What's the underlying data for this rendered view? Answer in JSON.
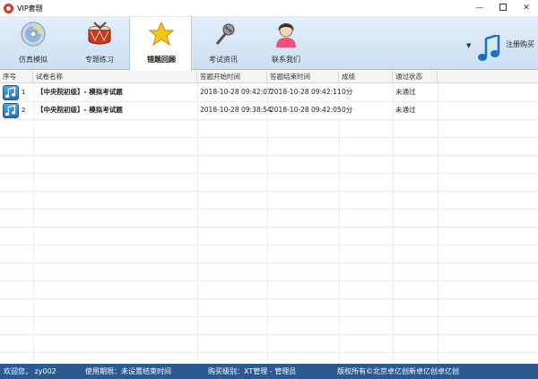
{
  "window": {
    "title": "VIP套题"
  },
  "toolbar": {
    "tools": [
      {
        "label": "仿真模拟",
        "icon": "cd-icon"
      },
      {
        "label": "专题练习",
        "icon": "drum-icon"
      },
      {
        "label": "错题回顾",
        "icon": "star-icon",
        "active": true
      },
      {
        "label": "考试资讯",
        "icon": "microphone-icon"
      },
      {
        "label": "联系我们",
        "icon": "support-person-icon"
      }
    ],
    "register_label": "注册购买"
  },
  "table": {
    "columns": [
      "序号",
      "试卷名称",
      "答题开始时间",
      "答题结束时间",
      "成绩",
      "通过状态"
    ],
    "rows": [
      {
        "seq": "1",
        "name": "【中央院初级】- 模拟考试题",
        "start": "2018-10-28 09:42:07",
        "end": "2018-10-28 09:42:11",
        "score": "0分",
        "status": "未通过"
      },
      {
        "seq": "2",
        "name": "【中央院初级】- 模拟考试题",
        "start": "2018-10-28 09:38:54",
        "end": "2018-10-28 09:42:05",
        "score": "0分",
        "status": "未通过"
      }
    ]
  },
  "status": {
    "welcome": "欢迎您， zy002",
    "period": "使用期限：未设置结束时间",
    "level": "购买级别：XT管理 - 管理员",
    "copyright": "版权所有©北京卓亿创新卓亿创卓亿创"
  },
  "colors": {
    "accent": "#2b5a93",
    "toolbar": "#d6e6f7"
  }
}
